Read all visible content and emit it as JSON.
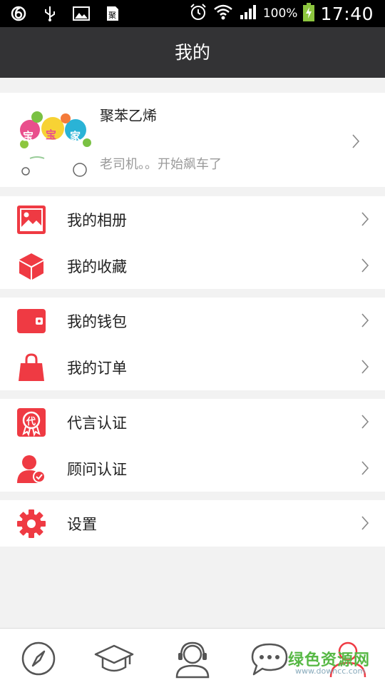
{
  "status_bar": {
    "battery": "100%",
    "time": "17:40"
  },
  "header": {
    "title": "我的"
  },
  "profile": {
    "name": "聚苯乙烯",
    "signature": "老司机。。开始飙车了",
    "avatar_text": [
      "宝",
      "宝",
      "家"
    ]
  },
  "menu": {
    "album": "我的相册",
    "favorites": "我的收藏",
    "wallet": "我的钱包",
    "orders": "我的订单",
    "spokesman_cert": "代言认证",
    "advisor_cert": "顾问认证",
    "settings": "设置",
    "spokesman_badge": "代"
  },
  "watermark": {
    "main": "绿色资源网",
    "sub": "www.downcc.com"
  },
  "colors": {
    "accent": "#ef3a43",
    "header_bg": "#333335",
    "statusbar_bg": "#000000",
    "watermark": "#57b845"
  },
  "tabs": [
    "compass-icon",
    "graduation-cap-icon",
    "headset-user-icon",
    "chat-bubble-icon",
    "user-icon"
  ]
}
